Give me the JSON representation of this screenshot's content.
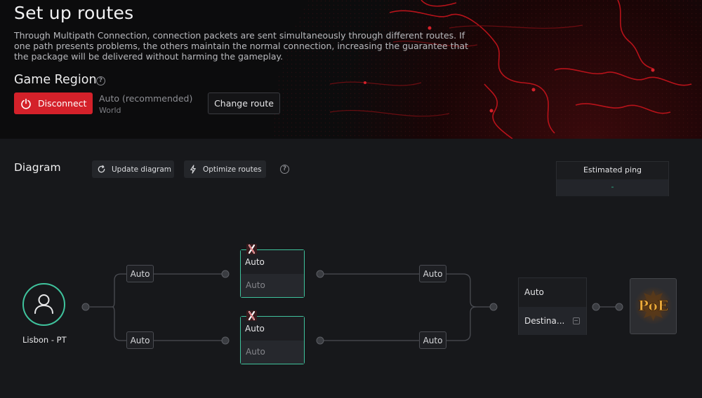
{
  "header": {
    "title": "Set up routes",
    "description": "Through Multipath Connection, connection packets are sent simultaneously through different routes. If one path presents problems, the others maintain the normal connection, increasing the guarantee that the package will be delivered without harming the gameplay.",
    "game_region": {
      "title": "Game Region",
      "disconnect_label": "Disconnect",
      "value": "Auto (recommended)",
      "sub": "World",
      "change_route_label": "Change route"
    }
  },
  "diagram": {
    "title": "Diagram",
    "update_label": "Update diagram",
    "optimize_label": "Optimize routes",
    "ping": {
      "label": "Estimated ping",
      "value": "-"
    },
    "origin": {
      "label": "Lisbon - PT"
    },
    "routes": [
      {
        "in_chip": "Auto",
        "node": {
          "label": "Auto",
          "sub": "Auto"
        },
        "out_chip": "Auto"
      },
      {
        "in_chip": "Auto",
        "node": {
          "label": "Auto",
          "sub": "Auto"
        },
        "out_chip": "Auto"
      }
    ],
    "destination": {
      "label": "Auto",
      "server": "Destina..."
    },
    "game": {
      "name": "PoE"
    }
  },
  "colors": {
    "accent_red": "#d4212a",
    "accent_green": "#3fc39d",
    "ping_value": "#2dbb8f"
  }
}
